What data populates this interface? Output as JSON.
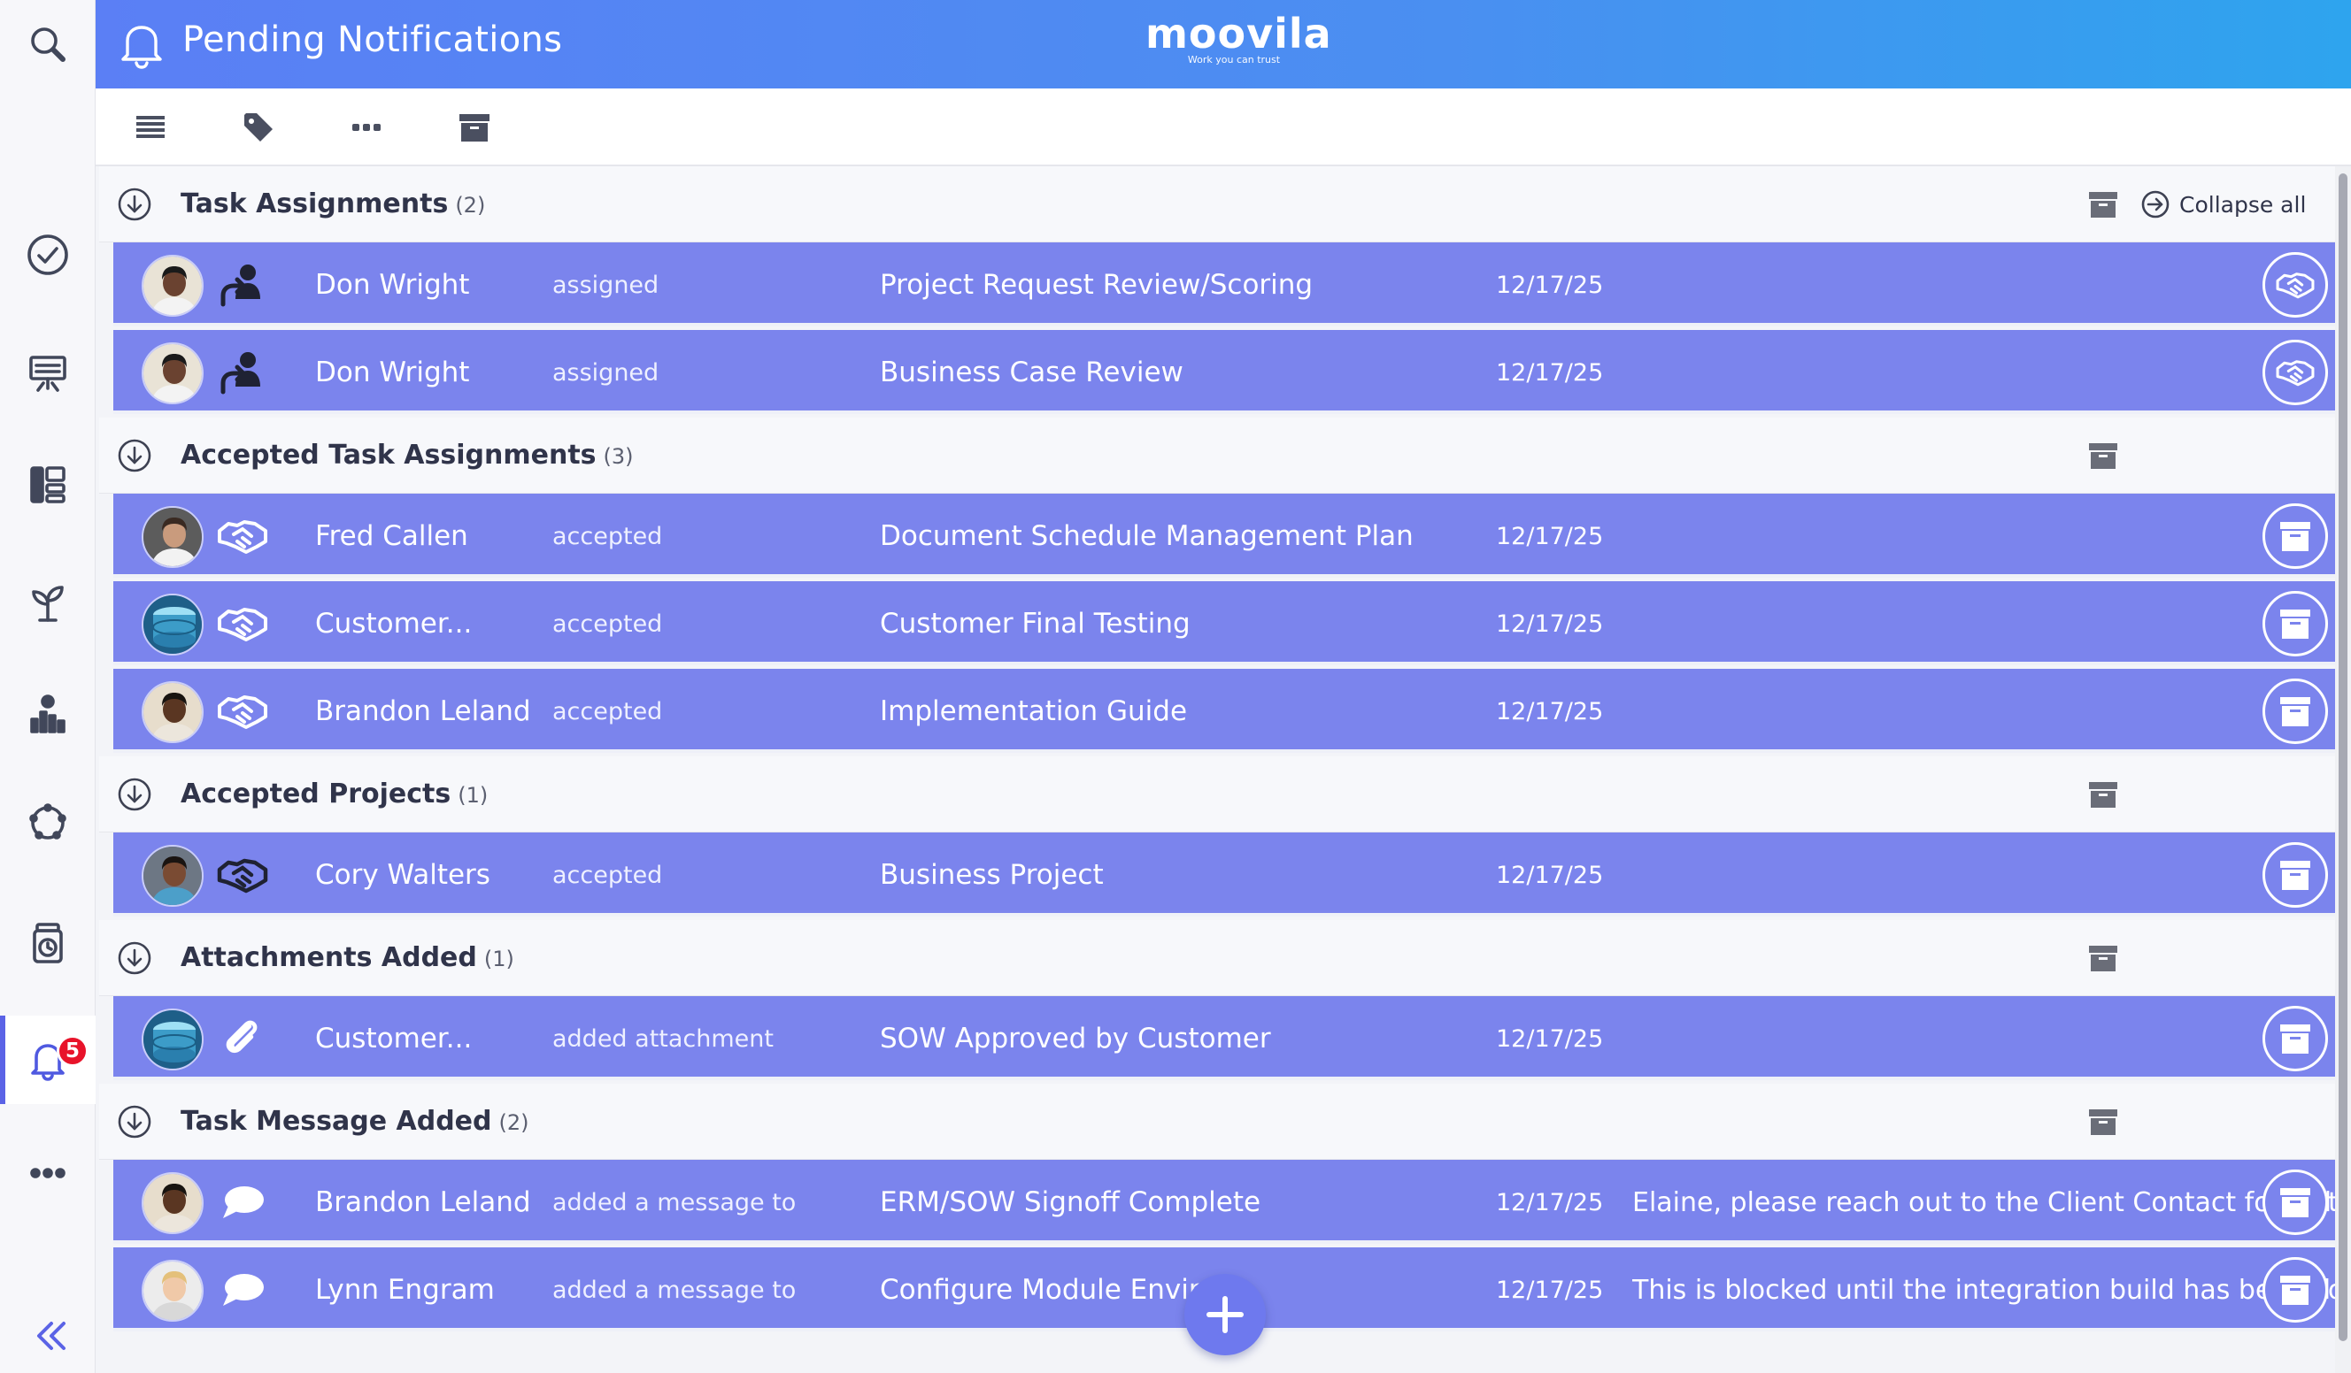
{
  "app": {
    "title": "Pending Notifications",
    "logo_text": "moovila",
    "logo_tagline": "Work you can trust",
    "accent_color": "#5b63e6",
    "row_color": "#7b84ed"
  },
  "sidebar": {
    "items": [
      {
        "icon": "search-icon"
      },
      {
        "icon": "check-circle-icon"
      },
      {
        "icon": "presentation-icon"
      },
      {
        "icon": "layout-icon"
      },
      {
        "icon": "sprout-icon"
      },
      {
        "icon": "team-chart-icon"
      },
      {
        "icon": "network-icon"
      },
      {
        "icon": "timer-jar-icon"
      },
      {
        "icon": "bell-icon",
        "active": true,
        "badge": "5"
      },
      {
        "icon": "more-icon"
      }
    ],
    "collapse_icon": "double-chevron-left-icon"
  },
  "toolbar": {
    "items": [
      "list-icon",
      "tag-icon",
      "more-dots-icon",
      "archive-icon"
    ]
  },
  "collapse_all_label": "Collapse all",
  "groups": [
    {
      "title": "Task Assignments",
      "count": "(2)",
      "rows": [
        {
          "name": "Don Wright",
          "action": "assigned",
          "item": "Project Request Review/Scoring",
          "date": "12/17/25",
          "message": "",
          "type_icon": "assign-icon",
          "button_icon": "handshake-icon"
        },
        {
          "name": "Don Wright",
          "action": "assigned",
          "item": "Business Case Review",
          "date": "12/17/25",
          "message": "",
          "type_icon": "assign-icon",
          "button_icon": "handshake-icon"
        }
      ]
    },
    {
      "title": "Accepted Task Assignments",
      "count": "(3)",
      "rows": [
        {
          "name": "Fred  Callen",
          "action": "accepted",
          "item": "Document Schedule Management Plan",
          "date": "12/17/25",
          "message": "",
          "type_icon": "handshake-icon",
          "button_icon": "archive-icon"
        },
        {
          "name": "Customer...",
          "action": "accepted",
          "item": "Customer Final Testing",
          "date": "12/17/25",
          "message": "",
          "type_icon": "handshake-icon",
          "button_icon": "archive-icon"
        },
        {
          "name": "Brandon Leland",
          "action": "accepted",
          "item": "Implementation Guide",
          "date": "12/17/25",
          "message": "",
          "type_icon": "handshake-icon",
          "button_icon": "archive-icon"
        }
      ]
    },
    {
      "title": "Accepted Projects",
      "count": "(1)",
      "rows": [
        {
          "name": "Cory Walters",
          "action": "accepted",
          "item": "Business Project",
          "date": "12/17/25",
          "message": "",
          "type_icon": "handshake-dark-icon",
          "button_icon": "archive-icon"
        }
      ]
    },
    {
      "title": "Attachments Added",
      "count": "(1)",
      "rows": [
        {
          "name": "Customer...",
          "action": "added attachment",
          "item": "SOW Approved by Customer",
          "date": "12/17/25",
          "message": "",
          "type_icon": "paperclip-icon",
          "button_icon": "archive-icon"
        }
      ]
    },
    {
      "title": "Task Message Added",
      "count": "(2)",
      "rows": [
        {
          "name": "Brandon Leland",
          "action": "added a message to",
          "item": "ERM/SOW Signoff Complete",
          "date": "12/17/25",
          "message": "Elaine, please reach out to the Client Contact for a stat",
          "message_tail": "tl",
          "type_icon": "chat-bubble-icon",
          "button_icon": "archive-icon"
        },
        {
          "name": "Lynn Engram",
          "action": "added a message to",
          "item": "Configure Module Enviror",
          "date": "12/17/25",
          "message": "This is blocked until the integration build has been con",
          "message_tail": "d",
          "type_icon": "chat-bubble-icon",
          "button_icon": "archive-icon"
        }
      ]
    }
  ]
}
